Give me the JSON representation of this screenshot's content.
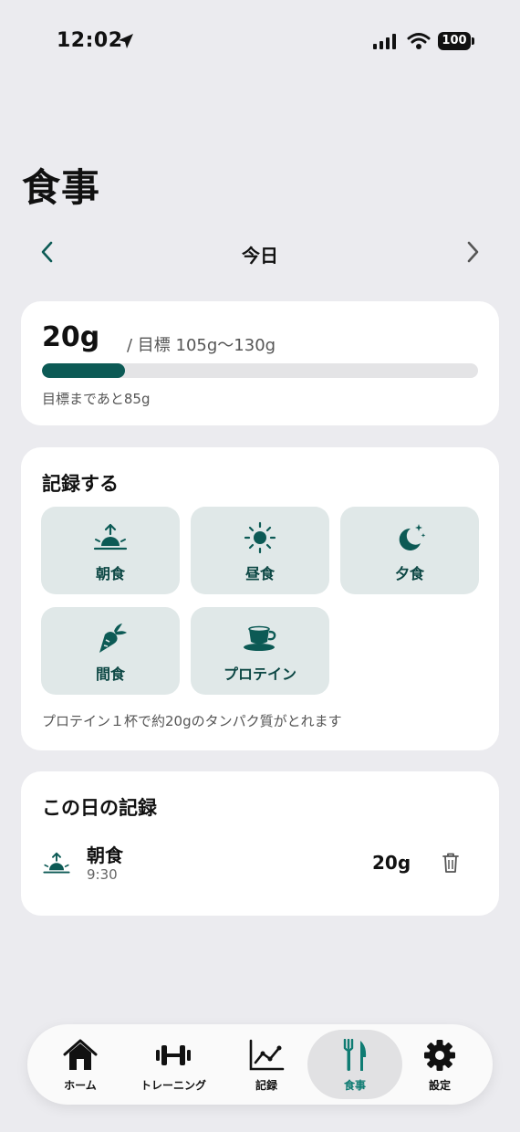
{
  "status": {
    "time": "12:02",
    "battery": "100"
  },
  "page": {
    "title": "食事"
  },
  "date_nav": {
    "label": "今日"
  },
  "goal": {
    "value": "20g",
    "target": "/ 目標 105g〜130g",
    "progress_fraction": 0.19,
    "remaining": "目標まであと85g"
  },
  "record": {
    "heading": "記録する",
    "buttons": [
      {
        "label": "朝食",
        "icon": "sunrise-icon"
      },
      {
        "label": "昼食",
        "icon": "sun-icon"
      },
      {
        "label": "夕食",
        "icon": "moon-stars-icon"
      },
      {
        "label": "間食",
        "icon": "carrot-icon"
      },
      {
        "label": "プロテイン",
        "icon": "cup-icon"
      }
    ],
    "note": "プロテイン１杯で約20gのタンパク質がとれます"
  },
  "log": {
    "heading": "この日の記録",
    "entries": [
      {
        "name": "朝食",
        "time": "9:30",
        "amount": "20g",
        "icon": "sunrise-icon"
      }
    ]
  },
  "tabs": [
    {
      "label": "ホーム",
      "icon": "home-icon",
      "active": false
    },
    {
      "label": "トレーニング",
      "icon": "dumbbell-icon",
      "active": false
    },
    {
      "label": "記録",
      "icon": "chart-icon",
      "active": false
    },
    {
      "label": "食事",
      "icon": "fork-knife-icon",
      "active": true
    },
    {
      "label": "設定",
      "icon": "gear-icon",
      "active": false
    }
  ],
  "colors": {
    "accent": "#0c5a55",
    "active_tab": "#0f7c73",
    "button_bg": "#e0e8e8",
    "background": "#ebebef"
  }
}
